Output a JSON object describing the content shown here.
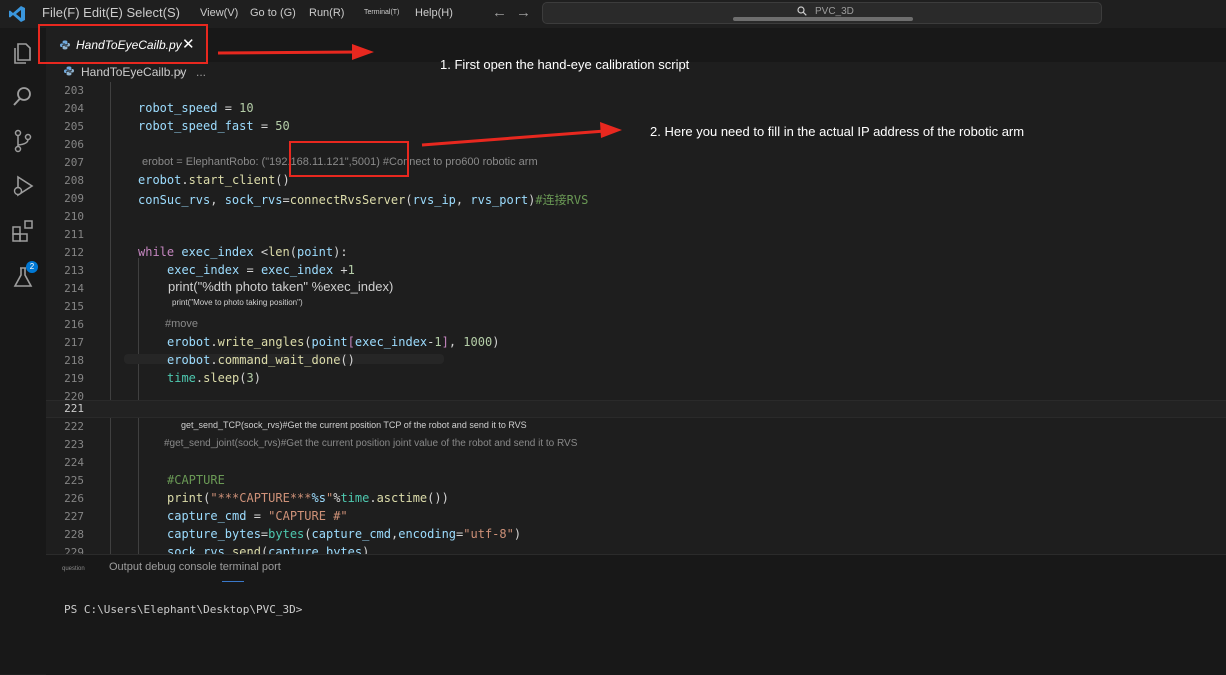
{
  "titlebar": {
    "menu_main": "File(F) Edit(E) Select(S)",
    "menu_view": "View(V)",
    "menu_goto": "Go to (G)",
    "menu_run": "Run(R)",
    "menu_terminal": "Terminal(T)",
    "menu_help": "Help(H)",
    "back_arrow": "←",
    "forward_arrow": "→",
    "command_center": "PVC_3D"
  },
  "activity_bar": {
    "items": [
      "explorer-icon",
      "search-icon",
      "source-control-icon",
      "run-debug-icon",
      "extensions-icon",
      "testing-icon"
    ],
    "extensions_badge": "2"
  },
  "tab": {
    "label": "HandToEyeCailb.py",
    "close": "✕"
  },
  "breadcrumb": {
    "file": "HandToEyeCailb.py",
    "separator": "›",
    "more": "..."
  },
  "editor": {
    "current_line": 221,
    "lines": [
      {
        "num": "203",
        "code": ""
      },
      {
        "num": "204",
        "code": "robot_speed = 10"
      },
      {
        "num": "205",
        "code": "robot_speed_fast = 50"
      },
      {
        "num": "206",
        "code": ""
      },
      {
        "num": "207",
        "code": "erobot = ElephantRobo: (\"192.168.11.121\",5001) #Connect to pro600 robotic arm"
      },
      {
        "num": "208",
        "code": "erobot.start_client()"
      },
      {
        "num": "209",
        "code": "conSuc_rvs, sock_rvs=connectRvsServer(rvs_ip, rvs_port)#连接RVS"
      },
      {
        "num": "210",
        "code": ""
      },
      {
        "num": "211",
        "code": ""
      },
      {
        "num": "212",
        "code": "while exec_index <len(point):"
      },
      {
        "num": "213",
        "code": "exec_index = exec_index +1"
      },
      {
        "num": "214",
        "code": "print(\"%dth photo taken\" %exec_index)"
      },
      {
        "num": "215",
        "code": "print(\"Move to photo taking position\")"
      },
      {
        "num": "216",
        "code": "#move"
      },
      {
        "num": "217",
        "code": "erobot.write_angles(point[exec_index-1], 1000)"
      },
      {
        "num": "218",
        "code": "erobot.command_wait_done()"
      },
      {
        "num": "219",
        "code": "time.sleep(3)"
      },
      {
        "num": "220",
        "code": ""
      },
      {
        "num": "221",
        "code": ""
      },
      {
        "num": "222",
        "code": "get_send_TCP(sock_rvs)#Get the current position TCP of the robot and send it to RVS"
      },
      {
        "num": "223",
        "code": "#get_send_joint(sock_rvs)#Get the current position joint value of the robot and send it to RVS"
      },
      {
        "num": "224",
        "code": ""
      },
      {
        "num": "225",
        "code": "#CAPTURE"
      },
      {
        "num": "226",
        "code": "print(\"***CAPTURE***%s\"%time.asctime())"
      },
      {
        "num": "227",
        "code": "capture_cmd = \"CAPTURE #\""
      },
      {
        "num": "228",
        "code": "capture_bytes=bytes(capture_cmd,encoding=\"utf-8\")"
      },
      {
        "num": "229",
        "code": "sock_rvs.send(capture_bytes)"
      }
    ]
  },
  "panel": {
    "question_label": "question",
    "tabs": "Output debug console terminal port",
    "terminal_prompt": "PS C:\\Users\\Elephant\\Desktop\\PVC_3D>"
  },
  "annotations": {
    "step1": "1. First open the hand-eye calibration script",
    "step2": "2. Here you need to fill in the actual IP address of the robotic arm",
    "color": "#e8281f"
  },
  "colors": {
    "editor_bg": "#1e1e1e",
    "sidebar_bg": "#181818",
    "keyword": "#c586c0",
    "string": "#ce9178",
    "number": "#b5cea8",
    "variable": "#9cdcfe",
    "function": "#dcdcaa",
    "comment": "#6a9955",
    "accent": "#0078d4"
  }
}
